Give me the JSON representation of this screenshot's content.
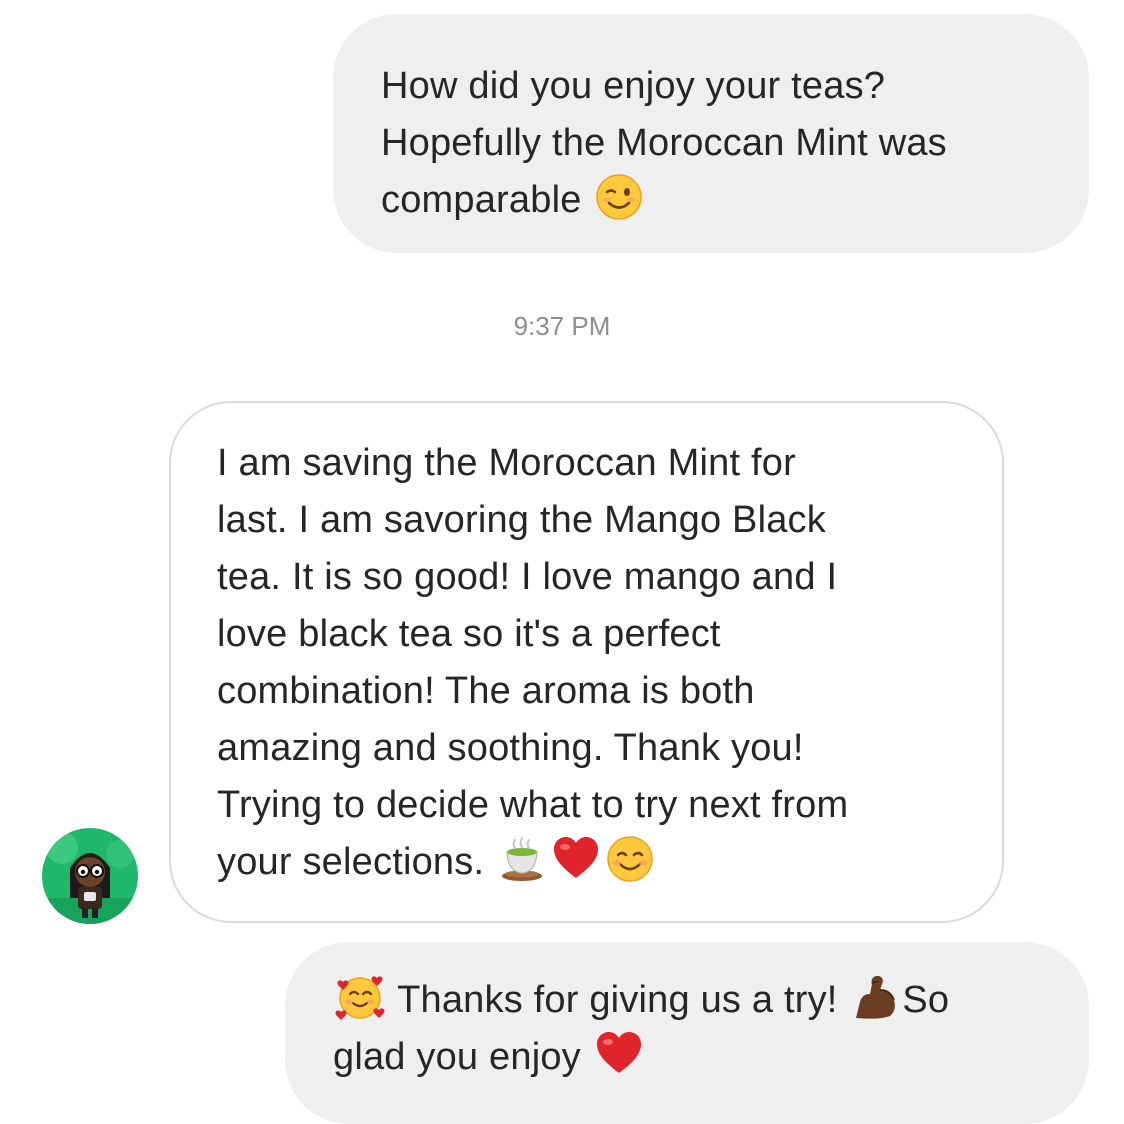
{
  "conversation": {
    "messages": [
      {
        "sender": "me",
        "lines": [
          "How did you enjoy your teas?",
          "Hopefully the Moroccan Mint was",
          "comparable"
        ],
        "emojis": [
          "winking-face-emoji"
        ]
      },
      {
        "sender": "other",
        "lines": [
          "I am saving the Moroccan Mint for",
          "last. I am savoring the Mango Black",
          "tea. It is so good! I love mango and I",
          "love black tea so it's a perfect",
          "combination! The aroma is both",
          "amazing and soothing. Thank you!",
          "Trying to decide what to try next from",
          "your selections."
        ],
        "emojis": [
          "teacup-emoji",
          "red-heart-emoji",
          "smiling-face-emoji"
        ]
      },
      {
        "sender": "me",
        "lines": [
          "Thanks for giving us a try!",
          "So",
          "glad you enjoy"
        ],
        "emojis": [
          "smiling-face-with-hearts-emoji",
          "flexed-biceps-emoji",
          "red-heart-emoji"
        ]
      }
    ],
    "timestamp": "9:37 PM"
  },
  "colors": {
    "sent_bubble": "#efefef",
    "received_bubble_border": "#dbdbdb",
    "text": "#262626",
    "timestamp": "#8e8e8e",
    "heart": "#e0242c",
    "emoji_yellow": "#ffc83d",
    "avatar_green": "#1fb86a"
  }
}
